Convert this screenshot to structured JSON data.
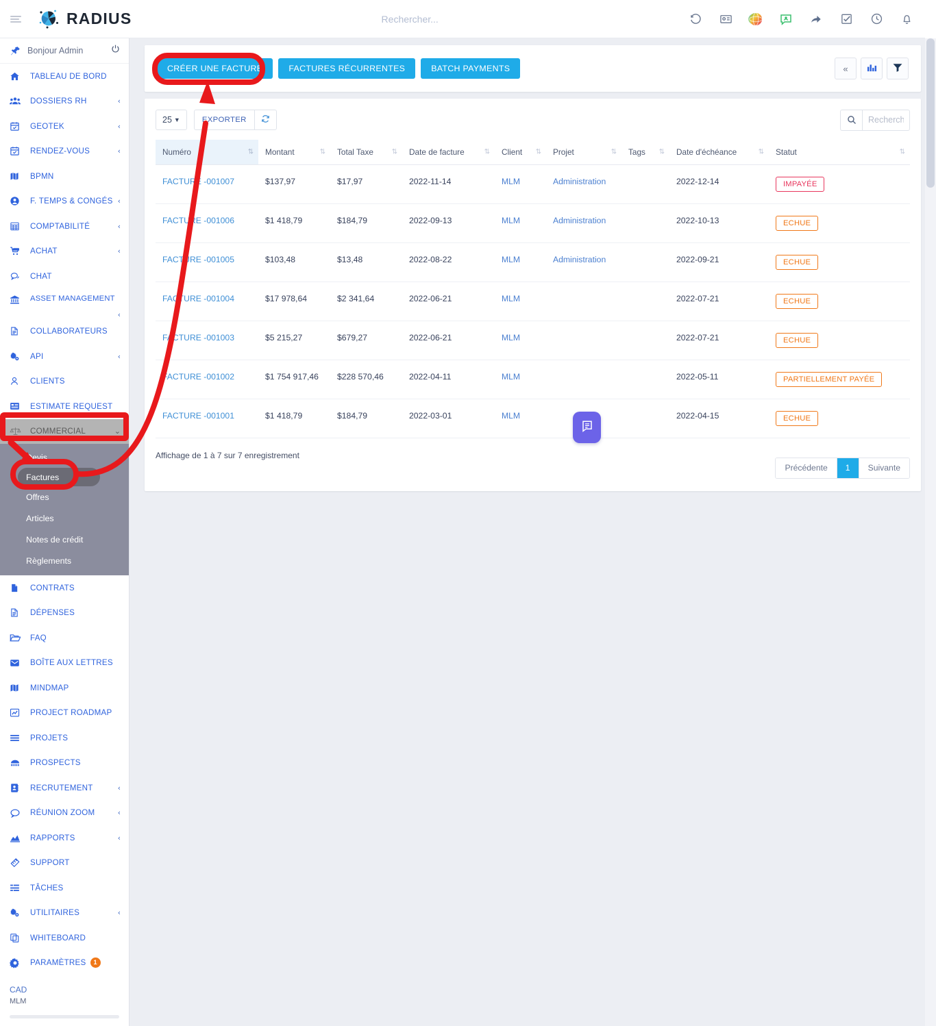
{
  "app": {
    "brand": "RADIUS",
    "menu_icon": "hamburger-icon"
  },
  "header": {
    "search_placeholder": "Rechercher...",
    "search_value": "",
    "icons": [
      {
        "name": "history-icon",
        "glyph": "↺"
      },
      {
        "name": "contact-card-icon",
        "glyph": "▤"
      },
      {
        "name": "globe-color-icon",
        "glyph": "◉"
      },
      {
        "name": "message-user-icon",
        "glyph": "▣"
      },
      {
        "name": "share-forward-icon",
        "glyph": "➦"
      },
      {
        "name": "checkbox-task-icon",
        "glyph": "☑"
      },
      {
        "name": "clock-icon",
        "glyph": "◷"
      },
      {
        "name": "bell-icon",
        "glyph": "🔔"
      }
    ]
  },
  "sidebar": {
    "greeting": "Bonjour Admin",
    "power_icon": "power-icon",
    "items": [
      {
        "label": "TABLEAU DE BORD",
        "icon": "home-icon",
        "caret": false
      },
      {
        "label": "DOSSIERS RH",
        "icon": "users-icon",
        "caret": true
      },
      {
        "label": "GEOTEK",
        "icon": "calendar-check-icon",
        "caret": true
      },
      {
        "label": "RENDEZ-VOUS",
        "icon": "calendar-check-icon",
        "caret": true
      },
      {
        "label": "BPMN",
        "icon": "map-icon",
        "caret": false
      },
      {
        "label": "F. TEMPS & CONGÉS",
        "icon": "user-circle-icon",
        "caret": true
      },
      {
        "label": "COMPTABILITÉ",
        "icon": "grid-table-icon",
        "caret": true
      },
      {
        "label": "ACHAT",
        "icon": "cart-icon",
        "caret": true
      },
      {
        "label": "CHAT",
        "icon": "chat-icon",
        "caret": false
      },
      {
        "label": "ASSET MANAGEMENT",
        "icon": "bank-icon",
        "caret": true
      },
      {
        "label": "COLLABORATEURS",
        "icon": "document-icon",
        "caret": false
      },
      {
        "label": "API",
        "icon": "gears-icon",
        "caret": true
      },
      {
        "label": "CLIENTS",
        "icon": "person-icon",
        "caret": false
      },
      {
        "label": "ESTIMATE REQUEST",
        "icon": "list-card-icon",
        "caret": false
      }
    ],
    "commercial": {
      "label": "COMMERCIAL",
      "icon": "scales-icon",
      "expanded": true,
      "sub_items": [
        {
          "label": "Devis",
          "selected": false
        },
        {
          "label": "Factures",
          "selected": true
        },
        {
          "label": "Offres",
          "selected": false
        },
        {
          "label": "Articles",
          "selected": false
        },
        {
          "label": "Notes de crédit",
          "selected": false
        },
        {
          "label": "Règlements",
          "selected": false
        }
      ]
    },
    "items_after": [
      {
        "label": "CONTRATS",
        "icon": "file-icon",
        "caret": false
      },
      {
        "label": "DÉPENSES",
        "icon": "document-icon",
        "caret": false
      },
      {
        "label": "FAQ",
        "icon": "folder-open-icon",
        "caret": false
      },
      {
        "label": "BOÎTE AUX LETTRES",
        "icon": "envelope-icon",
        "caret": false
      },
      {
        "label": "MINDMAP",
        "icon": "map-icon",
        "caret": false
      },
      {
        "label": "PROJECT ROADMAP",
        "icon": "chart-line-icon",
        "caret": false
      },
      {
        "label": "PROJETS",
        "icon": "bars-icon",
        "caret": false
      },
      {
        "label": "PROSPECTS",
        "icon": "prospects-icon",
        "caret": false
      },
      {
        "label": "RECRUTEMENT",
        "icon": "address-book-icon",
        "caret": true
      },
      {
        "label": "RÉUNION ZOOM",
        "icon": "speech-bubble-icon",
        "caret": true
      },
      {
        "label": "RAPPORTS",
        "icon": "chart-area-icon",
        "caret": true
      },
      {
        "label": "SUPPORT",
        "icon": "ticket-icon",
        "caret": false
      },
      {
        "label": "TÂCHES",
        "icon": "tasks-icon",
        "caret": false
      },
      {
        "label": "UTILITAIRES",
        "icon": "gears-icon",
        "caret": true
      },
      {
        "label": "WHITEBOARD",
        "icon": "copy-icon",
        "caret": false
      },
      {
        "label": "PARAMÈTRES",
        "icon": "gear-icon",
        "caret": false,
        "badge": "1"
      }
    ],
    "currency": "CAD",
    "company": "MLM"
  },
  "toolbar": {
    "create_invoice": "CRÉER UNE FACTURE",
    "recurring_invoices": "FACTURES RÉCURRENTES",
    "batch_payments": "BATCH PAYMENTS",
    "collapse_icon": "chevron-double-left-icon",
    "stats_icon": "bar-chart-icon",
    "filter_icon": "filter-icon"
  },
  "table_controls": {
    "page_size": "25",
    "export_label": "EXPORTER",
    "refresh_icon": "refresh-icon",
    "search_icon": "search-icon",
    "search_placeholder": "Recherche",
    "search_value": ""
  },
  "table": {
    "columns": [
      {
        "label": "Numéro",
        "sorted": true
      },
      {
        "label": "Montant",
        "sorted": false
      },
      {
        "label": "Total Taxe",
        "sorted": false
      },
      {
        "label": "Date de facture",
        "sorted": false
      },
      {
        "label": "Client",
        "sorted": false
      },
      {
        "label": "Projet",
        "sorted": false
      },
      {
        "label": "Tags",
        "sorted": false
      },
      {
        "label": "Date d'échéance",
        "sorted": false
      },
      {
        "label": "Statut",
        "sorted": false
      }
    ],
    "rows": [
      {
        "numero": "FACTURE -001007",
        "montant": "$137,97",
        "total_taxe": "$17,97",
        "date_facture": "2022-11-14",
        "client": "MLM",
        "projet": "Administration",
        "tags": "",
        "date_echeance": "2022-12-14",
        "statut": "IMPAYÉE",
        "statut_kind": "unpaid"
      },
      {
        "numero": "FACTURE -001006",
        "montant": "$1 418,79",
        "total_taxe": "$184,79",
        "date_facture": "2022-09-13",
        "client": "MLM",
        "projet": "Administration",
        "tags": "",
        "date_echeance": "2022-10-13",
        "statut": "ECHUE",
        "statut_kind": "overdue"
      },
      {
        "numero": "FACTURE -001005",
        "montant": "$103,48",
        "total_taxe": "$13,48",
        "date_facture": "2022-08-22",
        "client": "MLM",
        "projet": "Administration",
        "tags": "",
        "date_echeance": "2022-09-21",
        "statut": "ECHUE",
        "statut_kind": "overdue"
      },
      {
        "numero": "FACTURE -001004",
        "montant": "$17 978,64",
        "total_taxe": "$2 341,64",
        "date_facture": "2022-06-21",
        "client": "MLM",
        "projet": "",
        "tags": "",
        "date_echeance": "2022-07-21",
        "statut": "ECHUE",
        "statut_kind": "overdue"
      },
      {
        "numero": "FACTURE -001003",
        "montant": "$5 215,27",
        "total_taxe": "$679,27",
        "date_facture": "2022-06-21",
        "client": "MLM",
        "projet": "",
        "tags": "",
        "date_echeance": "2022-07-21",
        "statut": "ECHUE",
        "statut_kind": "overdue"
      },
      {
        "numero": "FACTURE -001002",
        "montant": "$1 754 917,46",
        "total_taxe": "$228 570,46",
        "date_facture": "2022-04-11",
        "client": "MLM",
        "projet": "",
        "tags": "",
        "date_echeance": "2022-05-11",
        "statut": "PARTIELLEMENT PAYÉE",
        "statut_kind": "partial"
      },
      {
        "numero": "FACTURE -001001",
        "montant": "$1 418,79",
        "total_taxe": "$184,79",
        "date_facture": "2022-03-01",
        "client": "MLM",
        "projet": "",
        "tags": "",
        "date_echeance": "2022-04-15",
        "statut": "ECHUE",
        "statut_kind": "overdue"
      }
    ]
  },
  "footer": {
    "info": "Affichage de 1 à 7 sur 7 enregistrement",
    "prev": "Précédente",
    "current_page": "1",
    "next": "Suivante"
  },
  "chat_fab": {
    "icon": "chat-message-icon"
  },
  "annotations": {
    "color": "#e8191c",
    "highlight_create_button": true,
    "highlight_commercial": true,
    "highlight_factures": true
  },
  "colors": {
    "accent_blue": "#1fabe8",
    "nav_link": "#2f63dd",
    "status_unpaid": "#e8365d",
    "status_overdue": "#f07818",
    "annotation_red": "#e8191c",
    "submenu_bg": "#8b8d9e",
    "active_group_bg": "#b4b4b4"
  }
}
